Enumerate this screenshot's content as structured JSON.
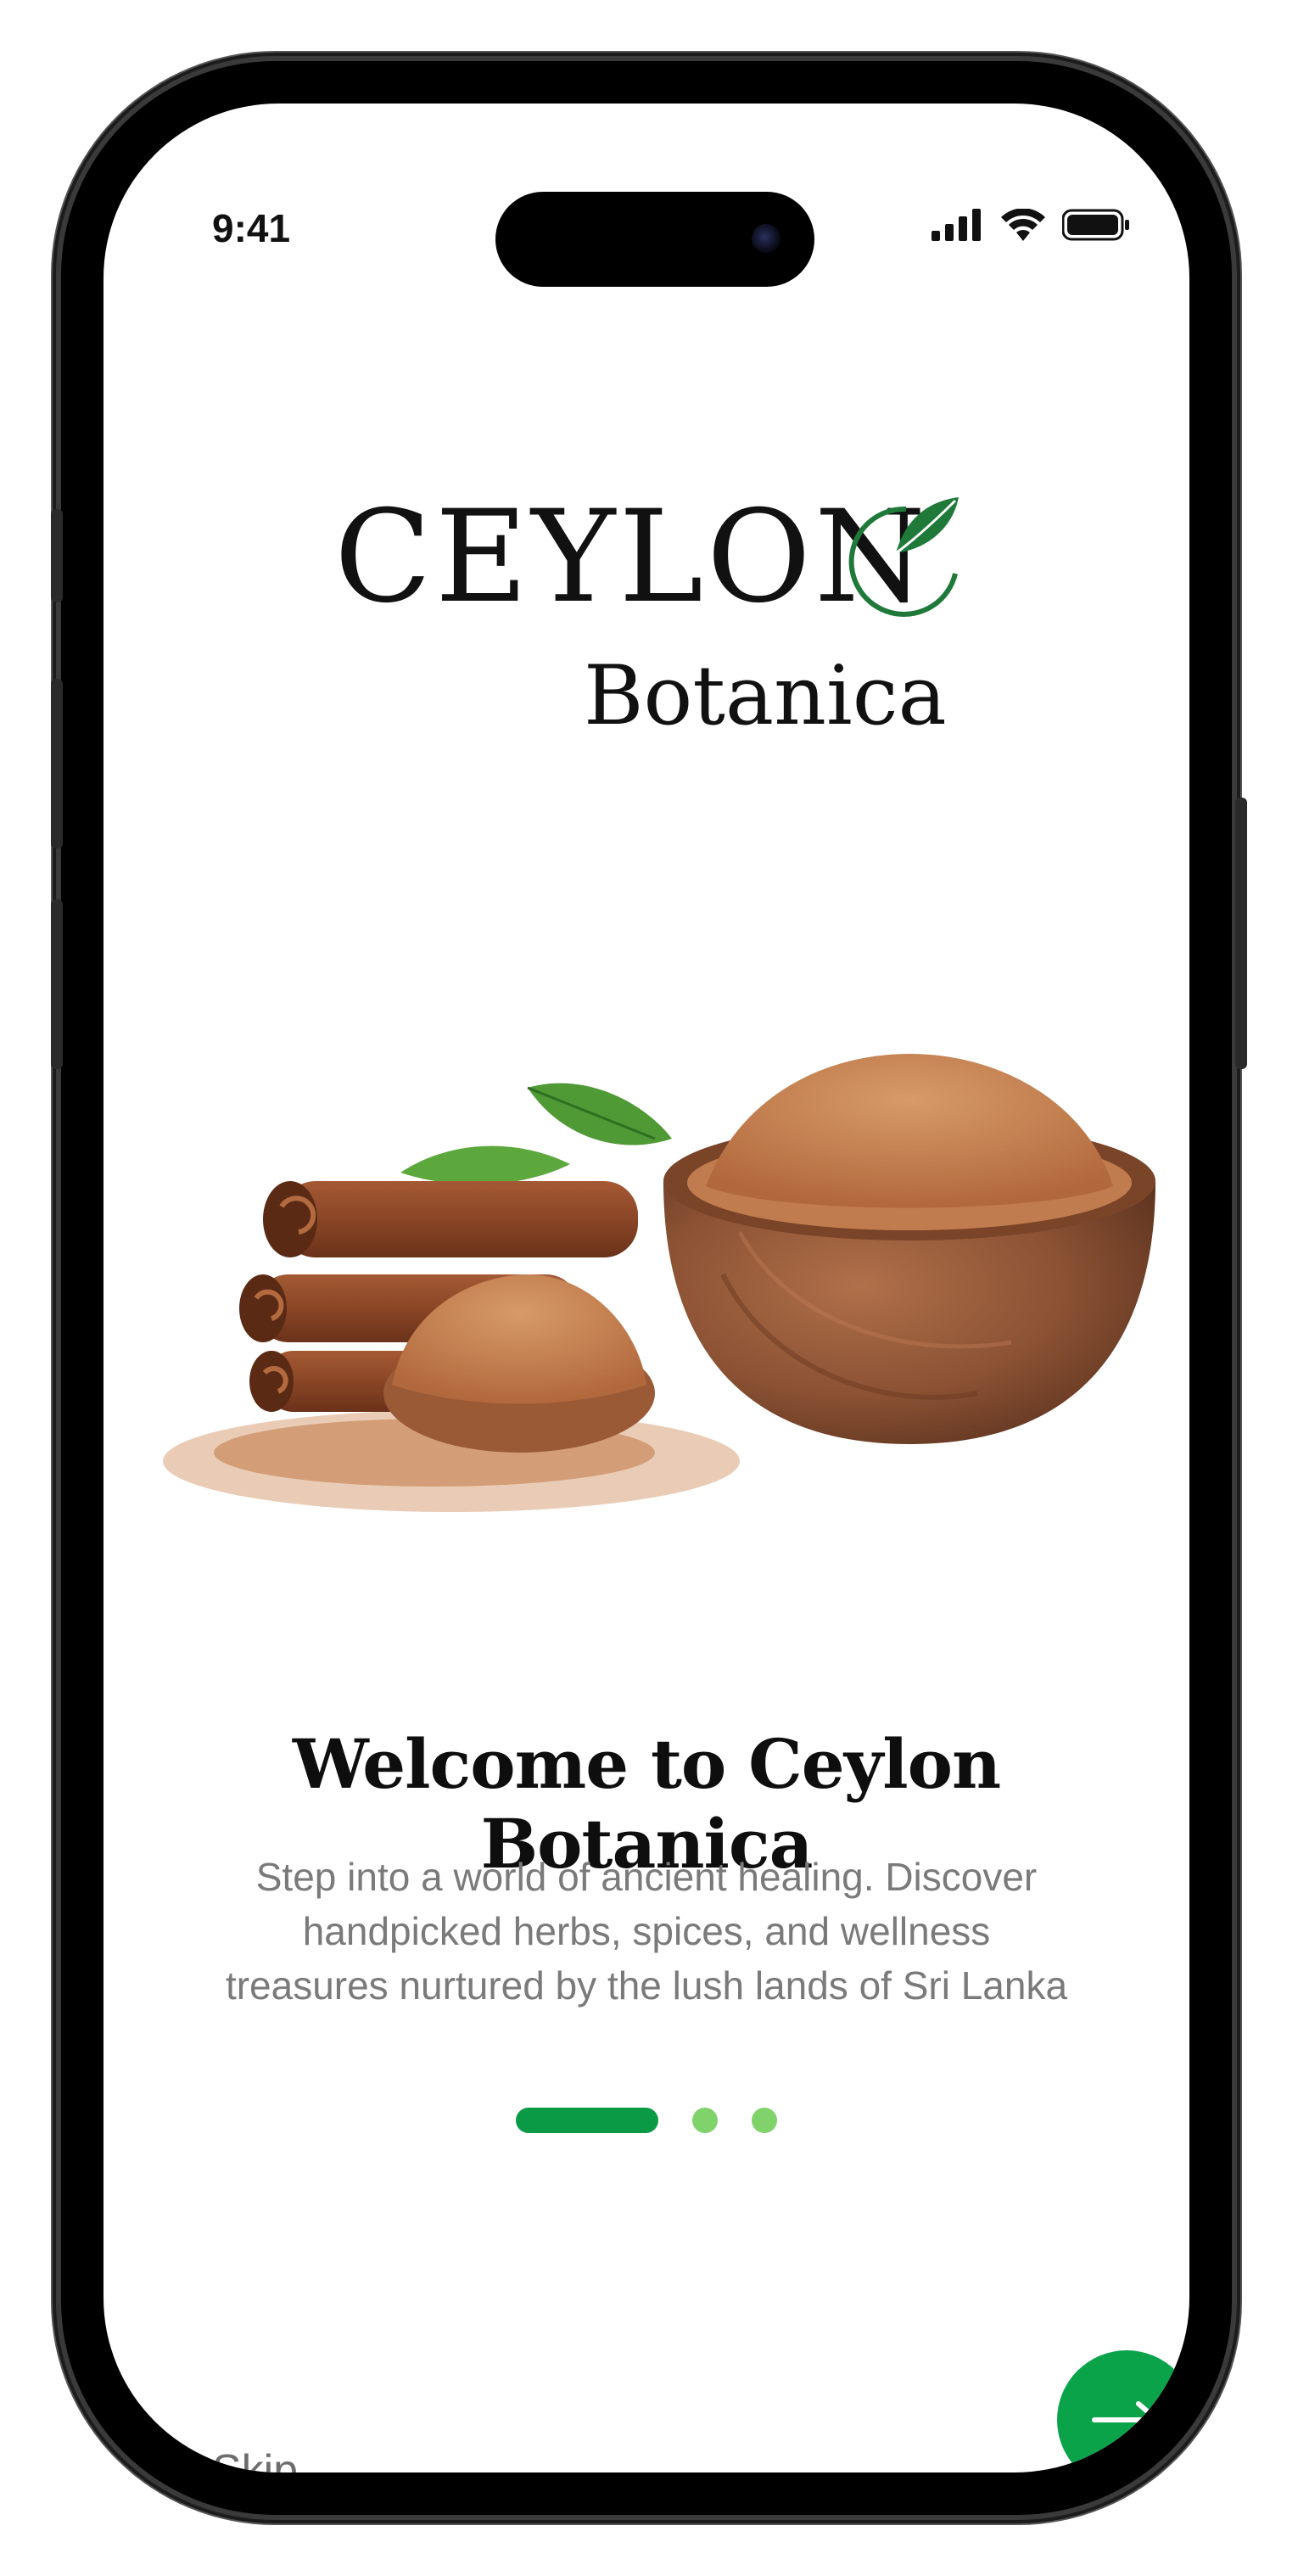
{
  "status_bar": {
    "time": "9:41",
    "icons": [
      "signal-icon",
      "wifi-icon",
      "battery-icon"
    ]
  },
  "brand": {
    "name": "CEYLON",
    "sub": "Botanica",
    "leaf_color": "#1f7a3a"
  },
  "hero": {
    "image": "cinnamon-sticks-powder-bowl-illustration"
  },
  "onboarding": {
    "title": "Welcome to Ceylon Botanica",
    "description": "Step into a world of ancient healing. Discover handpicked herbs, spices, and wellness treasures nurtured by the lush lands of Sri Lanka",
    "page_count": 3,
    "current_page": 1
  },
  "actions": {
    "skip_label": "Skip",
    "next_icon": "arrow-right-icon"
  },
  "colors": {
    "accent": "#0ba34a",
    "pager_active": "#0a9a45",
    "pager_inactive": "#7fd36a",
    "body_text": "#7a7a7a"
  }
}
